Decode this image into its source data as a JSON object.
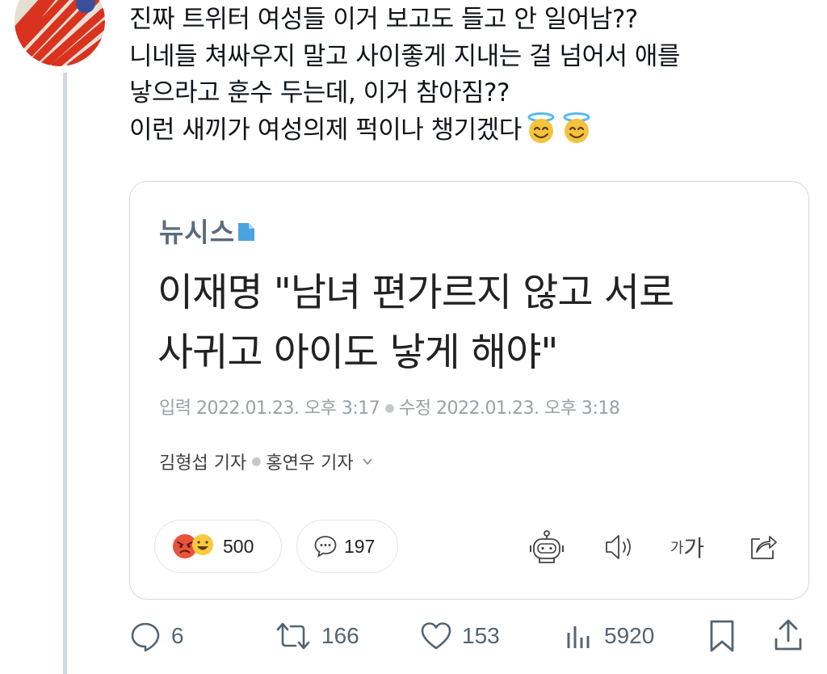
{
  "tweet": {
    "lines": [
      "진짜 트위터 여성들 이거 보고도 들고 안 일어남??",
      "니네들 쳐싸우지 말고 사이좋게 지내는 걸 넘어서 애를",
      "낳으라고 훈수 두는데, 이거 참아짐??",
      "이런 새끼가 여성의제 퍽이나 챙기겠다"
    ],
    "emoji": "smiling-face-with-halo"
  },
  "card": {
    "brand": "뉴시스",
    "headline_lines": [
      "이재명 \"남녀 편가르지 않고 서로",
      "사귀고 아이도 낳게 해야\""
    ],
    "dates": {
      "input": "입력 2022.01.23. 오후 3:17",
      "modified": "수정 2022.01.23. 오후 3:18"
    },
    "reporters": {
      "first": "김형섭 기자",
      "second": "홍연우 기자"
    },
    "reactions_count": "500",
    "comments_count": "197",
    "font_tool_small": "가",
    "font_tool_large": "가"
  },
  "actions": {
    "replies": "6",
    "retweets": "166",
    "likes": "153",
    "views": "5920"
  },
  "colors": {
    "thread_line": "#cfd9de",
    "action_icon": "#536471",
    "brand": "#5b6b7e",
    "brand_accent": "#4aa3df"
  }
}
